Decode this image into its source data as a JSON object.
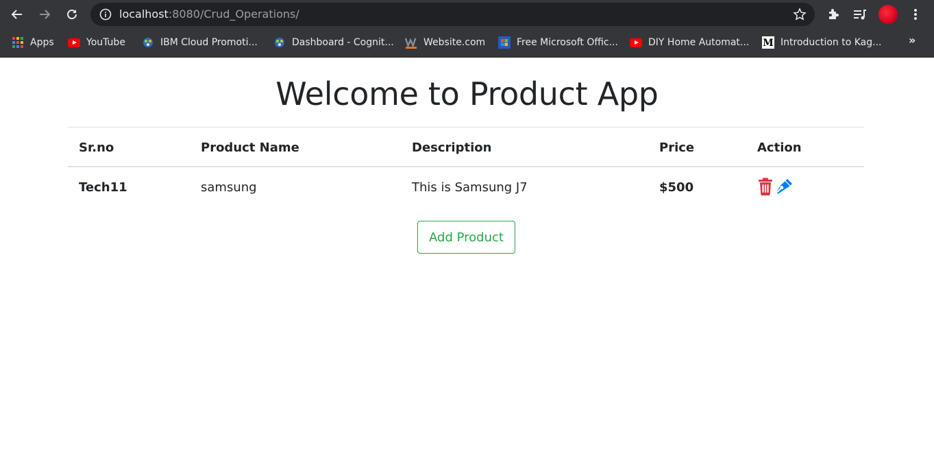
{
  "browser": {
    "url_host": "localhost",
    "url_rest": ":8080/Crud_Operations/",
    "bookmarks": [
      {
        "label": "Apps",
        "icon": "apps-grid-icon"
      },
      {
        "label": "YouTube",
        "icon": "youtube-icon"
      },
      {
        "label": "IBM Cloud Promoti...",
        "icon": "ibm-cloud-icon"
      },
      {
        "label": "Dashboard - Cognit...",
        "icon": "cognitive-dashboard-icon"
      },
      {
        "label": "Website.com",
        "icon": "website-w-icon"
      },
      {
        "label": "Free Microsoft Offic...",
        "icon": "microsoft-office-icon"
      },
      {
        "label": "DIY Home Automat...",
        "icon": "youtube-icon"
      },
      {
        "label": "Introduction to Kag...",
        "icon": "medium-m-icon"
      }
    ],
    "more_label": "»"
  },
  "page": {
    "title": "Welcome to Product App",
    "table": {
      "headers": [
        "Sr.no",
        "Product Name",
        "Description",
        "Price",
        "Action"
      ],
      "rows": [
        {
          "srno": "Tech11",
          "name": "samsung",
          "description": "This is Samsung J7",
          "price": "$500"
        }
      ]
    },
    "add_button": "Add Product"
  },
  "colors": {
    "delete": "#dc3545",
    "edit": "#007bff",
    "add_button": "#28a745",
    "text": "#212529"
  }
}
